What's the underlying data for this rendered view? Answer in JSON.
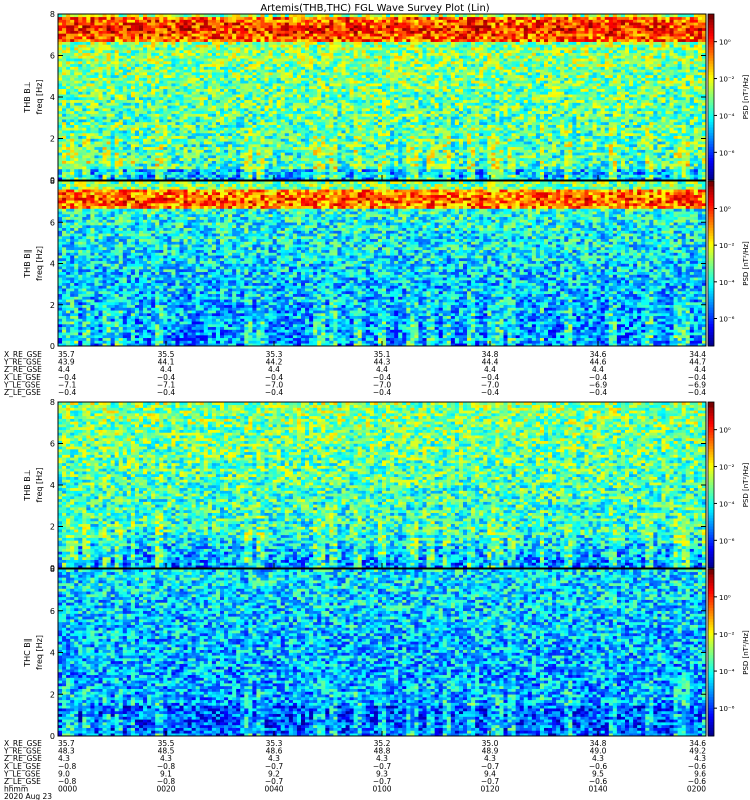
{
  "chart_data": {
    "type": "heatmap",
    "title": "Artemis(THB,THC) FGL Wave Survey Plot (Lin)",
    "date_label": "2020 Aug 23",
    "time_ticks": [
      "0000",
      "0020",
      "0040",
      "0100",
      "0120",
      "0140",
      "0200"
    ],
    "time_row_label": "hhmm",
    "colorbar": {
      "scale": "log",
      "colormap": "jet",
      "label": "PSD [nT²/Hz]"
    },
    "panels": [
      {
        "id": "thb-bl-1",
        "ylabel": "THB B⊥",
        "ylabel2": "freq [Hz]",
        "ylim": [
          0,
          8
        ],
        "yticks": [
          "0",
          "2",
          "4",
          "6",
          "8"
        ],
        "cbar_ticks": [
          "10⁰",
          "10⁻²",
          "10⁻⁴",
          "10⁻⁶"
        ],
        "cbar_exps": [
          0,
          -2,
          -4,
          -6
        ],
        "intensity": "high-band at 6.5-8 Hz, moderate below"
      },
      {
        "id": "thb-bl-2",
        "ylabel": "THB B∥",
        "ylabel2": "freq [Hz]",
        "ylim": [
          0,
          8
        ],
        "yticks": [
          "0",
          "2",
          "4",
          "6",
          "8"
        ],
        "cbar_ticks": [
          "10⁰",
          "10⁻²",
          "10⁻⁴",
          "10⁻⁶"
        ],
        "cbar_exps": [
          0,
          -2,
          -4,
          -6
        ],
        "intensity": "band at 6.5-7.5 Hz, low below"
      },
      {
        "id": "thb-bl-3",
        "ylabel": "THB B⊥",
        "ylabel2": "freq [Hz]",
        "ylim": [
          0,
          8
        ],
        "yticks": [
          "0",
          "2",
          "4",
          "6",
          "8"
        ],
        "cbar_ticks": [
          "10⁰",
          "10⁻²",
          "10⁻⁴",
          "10⁻⁶"
        ],
        "cbar_exps": [
          0,
          -2,
          -4,
          -6
        ],
        "intensity": "moderate high frequencies, low near 0-1 Hz"
      },
      {
        "id": "thc-bpar",
        "ylabel": "THC B∥",
        "ylabel2": "freq [Hz]",
        "ylim": [
          0,
          8
        ],
        "yticks": [
          "0",
          "2",
          "4",
          "6",
          "8"
        ],
        "cbar_ticks": [
          "10⁰",
          "10⁻²",
          "10⁻⁴",
          "10⁻⁶"
        ],
        "cbar_exps": [
          0,
          -2,
          -4,
          -6
        ],
        "intensity": "low overall"
      }
    ],
    "ephemeris_top": {
      "labels": [
        "X_RE_GSE",
        "Y_RE_GSE",
        "Z_RE_GSE",
        "X_LE_GSE",
        "Y_LE_GSE",
        "Z_LE_GSE"
      ],
      "rows": [
        [
          "35.7",
          "35.5",
          "35.3",
          "35.1",
          "34.8",
          "34.6",
          "34.4"
        ],
        [
          "43.9",
          "44.1",
          "44.2",
          "44.3",
          "44.4",
          "44.6",
          "44.7"
        ],
        [
          "4.4",
          "4.4",
          "4.4",
          "4.4",
          "4.4",
          "4.4",
          "4.4"
        ],
        [
          "−0.4",
          "−0.4",
          "−0.4",
          "−0.4",
          "−0.4",
          "−0.4",
          "−0.4"
        ],
        [
          "−7.1",
          "−7.1",
          "−7.0",
          "−7.0",
          "−7.0",
          "−6.9",
          "−6.9"
        ],
        [
          "−0.4",
          "−0.4",
          "−0.4",
          "−0.4",
          "−0.4",
          "−0.4",
          "−0.4"
        ]
      ]
    },
    "ephemeris_bottom": {
      "labels": [
        "X_RE_GSE",
        "Y_RE_GSE",
        "Z_RE_GSE",
        "X_LE_GSE",
        "Y_LE_GSE",
        "Z_LE_GSE"
      ],
      "rows": [
        [
          "35.7",
          "35.5",
          "35.3",
          "35.2",
          "35.0",
          "34.8",
          "34.6"
        ],
        [
          "48.3",
          "48.5",
          "48.6",
          "48.8",
          "48.9",
          "49.0",
          "49.2"
        ],
        [
          "4.3",
          "4.3",
          "4.3",
          "4.3",
          "4.3",
          "4.3",
          "4.3"
        ],
        [
          "−0.8",
          "−0.8",
          "−0.7",
          "−0.7",
          "−0.7",
          "−0.6",
          "−0.6"
        ],
        [
          "9.0",
          "9.1",
          "9.2",
          "9.3",
          "9.4",
          "9.5",
          "9.6"
        ],
        [
          "−0.8",
          "−0.8",
          "−0.7",
          "−0.7",
          "−0.7",
          "−0.6",
          "−0.6"
        ]
      ]
    }
  }
}
